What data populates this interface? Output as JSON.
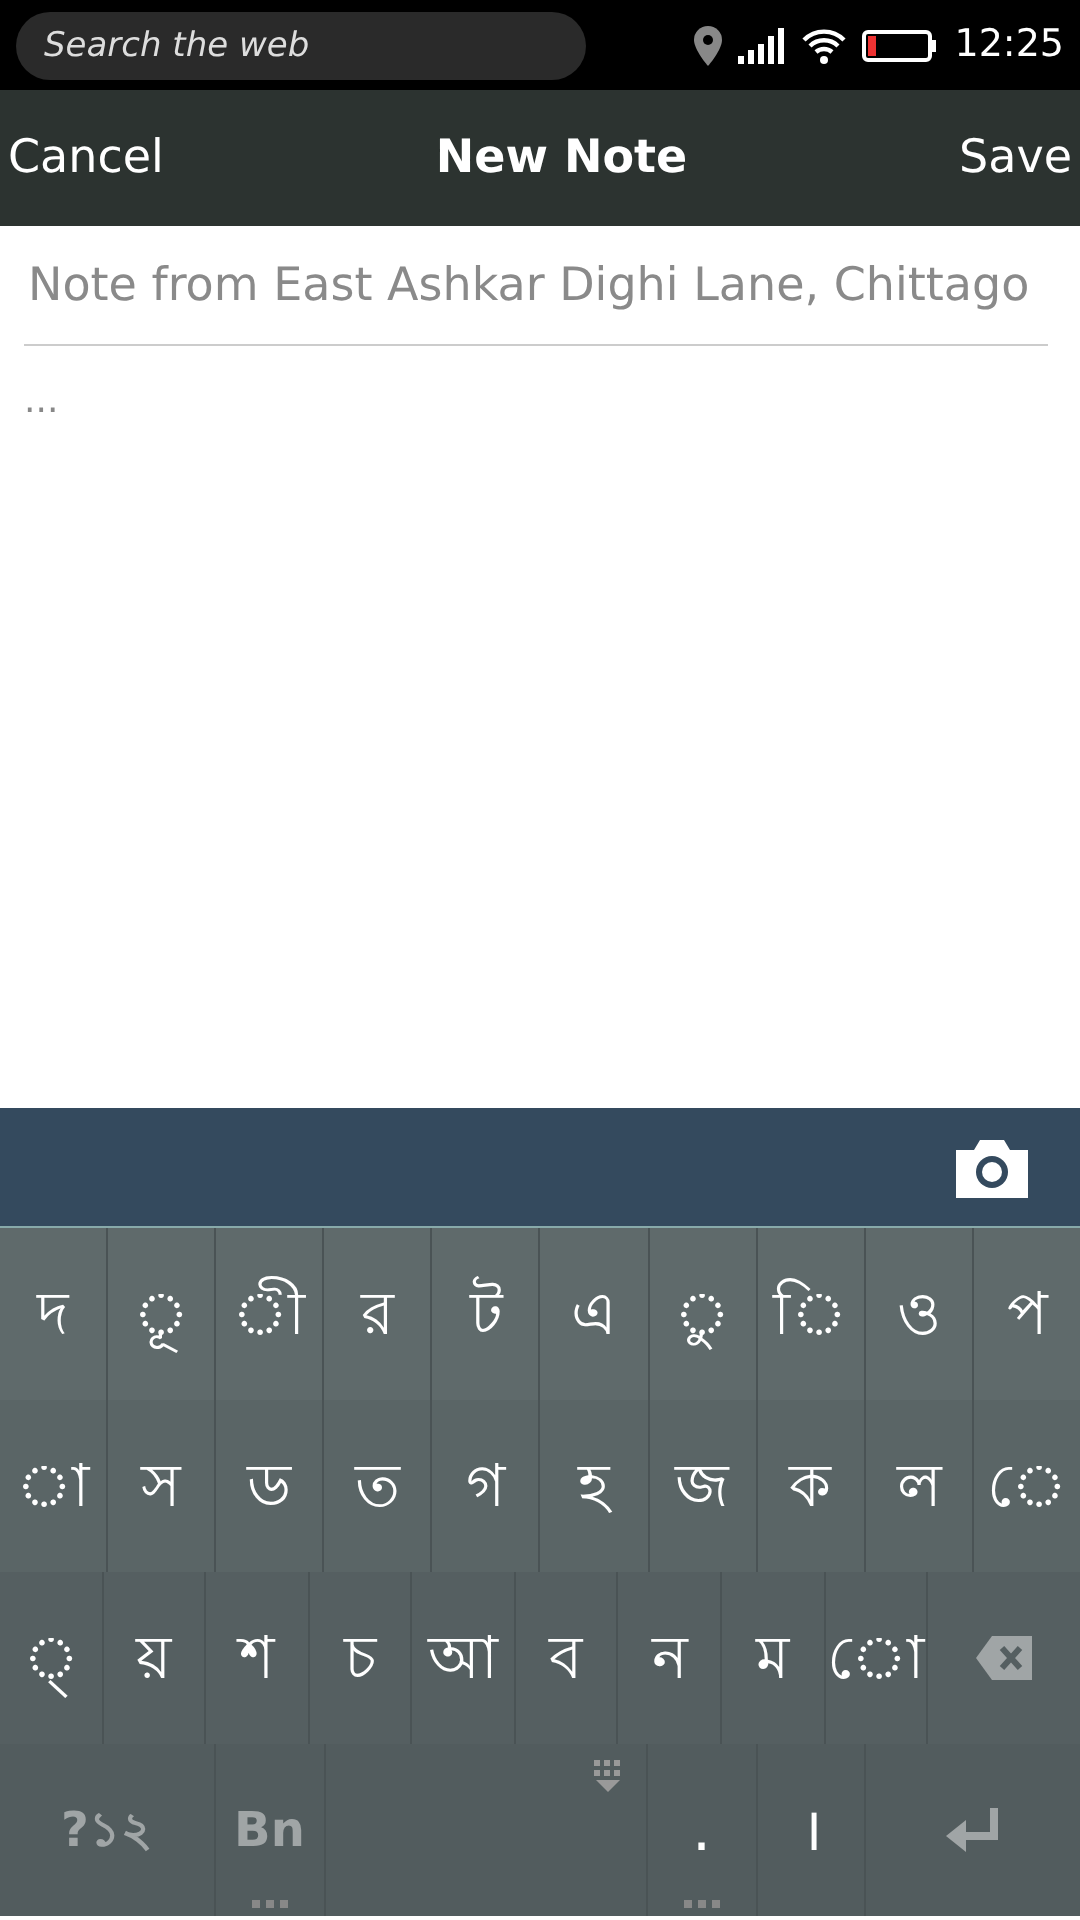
{
  "status_bar": {
    "search_placeholder": "Search the web",
    "time": "12:25"
  },
  "header": {
    "cancel": "Cancel",
    "title": "New Note",
    "save": "Save"
  },
  "note": {
    "title_placeholder": "Note from East Ashkar Dighi Lane, Chittago",
    "body_placeholder": "..."
  },
  "keyboard": {
    "rows": [
      {
        "keys": [
          {
            "kind": "char",
            "label": "দ"
          },
          {
            "kind": "char",
            "label": "◌ূ"
          },
          {
            "kind": "char",
            "label": "◌ী"
          },
          {
            "kind": "char",
            "label": "র"
          },
          {
            "kind": "char",
            "label": "ট"
          },
          {
            "kind": "char",
            "label": "এ"
          },
          {
            "kind": "char",
            "label": "◌ু"
          },
          {
            "kind": "char",
            "label": "◌ি"
          },
          {
            "kind": "char",
            "label": "ও"
          },
          {
            "kind": "char",
            "label": "প"
          }
        ]
      },
      {
        "keys": [
          {
            "kind": "char",
            "label": "◌া"
          },
          {
            "kind": "char",
            "label": "স"
          },
          {
            "kind": "char",
            "label": "ড"
          },
          {
            "kind": "char",
            "label": "ত"
          },
          {
            "kind": "char",
            "label": "গ"
          },
          {
            "kind": "char",
            "label": "হ"
          },
          {
            "kind": "char",
            "label": "জ"
          },
          {
            "kind": "char",
            "label": "ক"
          },
          {
            "kind": "char",
            "label": "ল"
          },
          {
            "kind": "char",
            "label": "◌ে"
          }
        ]
      },
      {
        "keys": [
          {
            "kind": "char",
            "label": "◌্"
          },
          {
            "kind": "char",
            "label": "য়"
          },
          {
            "kind": "char",
            "label": "শ"
          },
          {
            "kind": "char",
            "label": "চ"
          },
          {
            "kind": "char",
            "label": "আ"
          },
          {
            "kind": "char",
            "label": "ব"
          },
          {
            "kind": "char",
            "label": "ন"
          },
          {
            "kind": "char",
            "label": "ম"
          },
          {
            "kind": "char",
            "label": "◌ো"
          },
          {
            "kind": "backspace"
          }
        ]
      },
      {
        "keys": [
          {
            "kind": "symbols",
            "label": "?১২"
          },
          {
            "kind": "language",
            "label": "Bn",
            "more": true
          },
          {
            "kind": "space"
          },
          {
            "kind": "char",
            "label": ".",
            "more": true
          },
          {
            "kind": "char",
            "label": "।"
          },
          {
            "kind": "enter"
          }
        ]
      }
    ]
  }
}
